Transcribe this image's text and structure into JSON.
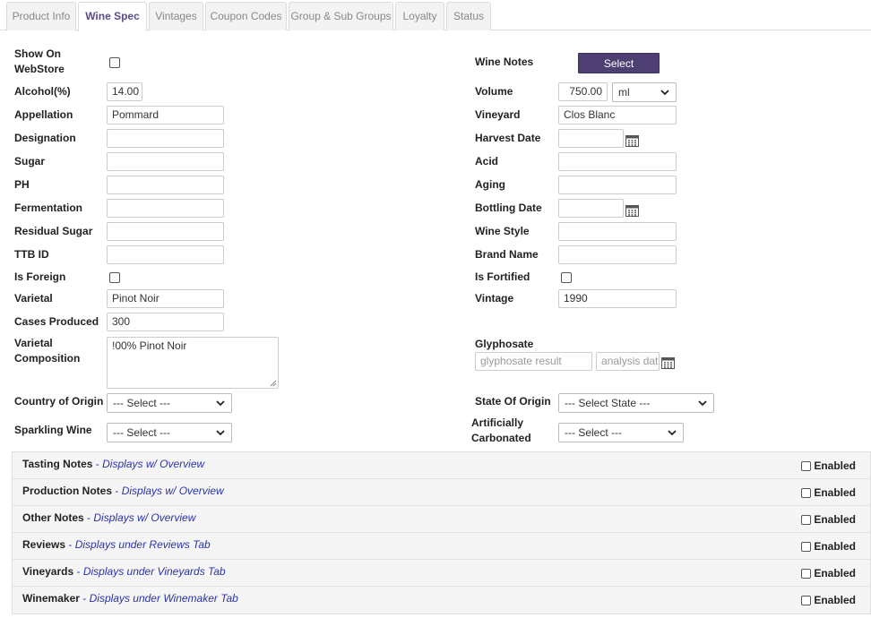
{
  "tabs": [
    {
      "label": "Product Info"
    },
    {
      "label": "Wine Spec",
      "active": true
    },
    {
      "label": "Vintages"
    },
    {
      "label": "Coupon Codes"
    },
    {
      "label": "Group & Sub Groups"
    },
    {
      "label": "Loyalty"
    },
    {
      "label": "Status"
    }
  ],
  "left": {
    "show_on_webstore": {
      "label": "Show On WebStore",
      "checked": false
    },
    "alcohol": {
      "label": "Alcohol(%)",
      "value": "14.00"
    },
    "appellation": {
      "label": "Appellation",
      "value": "Pommard"
    },
    "designation": {
      "label": "Designation",
      "value": ""
    },
    "sugar": {
      "label": "Sugar",
      "value": ""
    },
    "ph": {
      "label": "PH",
      "value": ""
    },
    "fermentation": {
      "label": "Fermentation",
      "value": ""
    },
    "residual_sugar": {
      "label": "Residual Sugar",
      "value": ""
    },
    "ttb_id": {
      "label": "TTB ID",
      "value": ""
    },
    "is_foreign": {
      "label": "Is Foreign",
      "checked": false
    },
    "varietal": {
      "label": "Varietal",
      "value": "Pinot Noir"
    },
    "cases_produced": {
      "label": "Cases Produced",
      "value": "300"
    },
    "varietal_composition": {
      "label": "Varietal Composition",
      "value": "!00% Pinot Noir"
    },
    "country_of_origin": {
      "label": "Country of Origin",
      "value": "--- Select ---"
    },
    "sparkling_wine": {
      "label": "Sparkling Wine",
      "value": "--- Select ---"
    }
  },
  "right": {
    "wine_notes": {
      "label": "Wine Notes",
      "button": "Select"
    },
    "volume": {
      "label": "Volume",
      "value": "750.00",
      "unit": "ml"
    },
    "vineyard": {
      "label": "Vineyard",
      "value": "Clos Blanc"
    },
    "harvest_date": {
      "label": "Harvest Date",
      "value": ""
    },
    "acid": {
      "label": "Acid",
      "value": ""
    },
    "aging": {
      "label": "Aging",
      "value": ""
    },
    "bottling_date": {
      "label": "Bottling Date",
      "value": ""
    },
    "wine_style": {
      "label": "Wine Style",
      "value": ""
    },
    "brand_name": {
      "label": "Brand Name",
      "value": ""
    },
    "is_fortified": {
      "label": "Is Fortified",
      "checked": false
    },
    "vintage": {
      "label": "Vintage",
      "value": "1990"
    },
    "glyphosate": {
      "label": "Glyphosate",
      "result_placeholder": "glyphosate result",
      "date_placeholder": "analysis date"
    },
    "state_of_origin": {
      "label": "State Of Origin",
      "value": "--- Select State ---"
    },
    "artificially_carbonated": {
      "label": "Artificially Carbonated",
      "value": "--- Select ---"
    }
  },
  "notes": [
    {
      "title": "Tasting Notes",
      "sub": "Displays w/ Overview",
      "enabled_label": "Enabled"
    },
    {
      "title": "Production Notes",
      "sub": "Displays w/ Overview",
      "enabled_label": "Enabled"
    },
    {
      "title": "Other Notes",
      "sub": "Displays w/ Overview",
      "enabled_label": "Enabled"
    },
    {
      "title": "Reviews",
      "sub": "Displays under Reviews Tab",
      "enabled_label": "Enabled"
    },
    {
      "title": "Vineyards",
      "sub": "Displays under Vineyards Tab",
      "enabled_label": "Enabled"
    },
    {
      "title": "Winemaker",
      "sub": "Displays under Winemaker Tab",
      "enabled_label": "Enabled"
    }
  ],
  "colors": {
    "accent": "#4e3f72",
    "link": "#2a33a8",
    "tab_active": "#5b4b87"
  },
  "icons": {
    "calendar": "calendar-icon",
    "chevron": "chevron-down-icon"
  }
}
